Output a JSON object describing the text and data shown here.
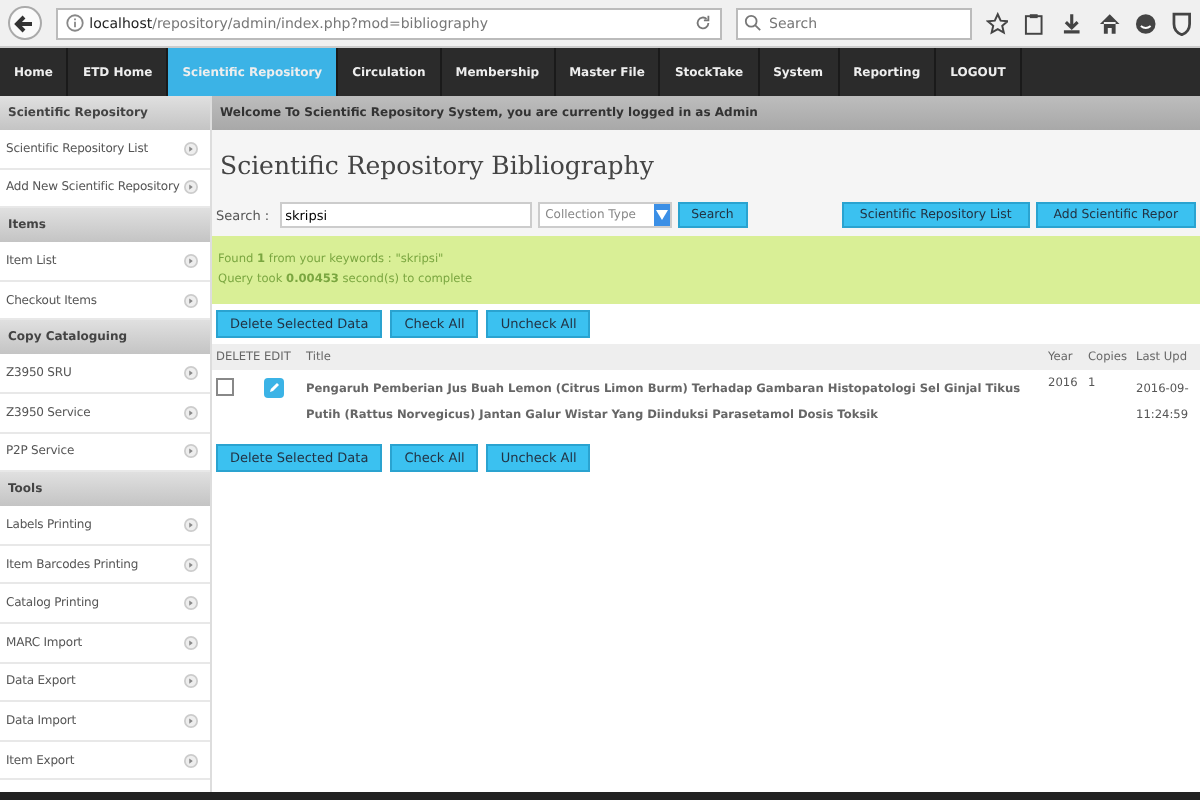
{
  "browser": {
    "url_host": "localhost",
    "url_path": "/repository/admin/index.php?mod=bibliography",
    "search_placeholder": "Search"
  },
  "nav": [
    {
      "label": "Home",
      "selected": false
    },
    {
      "label": "ETD Home",
      "selected": false
    },
    {
      "label": "Scientific Repository",
      "selected": true
    },
    {
      "label": "Circulation",
      "selected": false
    },
    {
      "label": "Membership",
      "selected": false
    },
    {
      "label": "Master File",
      "selected": false
    },
    {
      "label": "StockTake",
      "selected": false
    },
    {
      "label": "System",
      "selected": false
    },
    {
      "label": "Reporting",
      "selected": false
    },
    {
      "label": "LOGOUT",
      "selected": false
    }
  ],
  "sidebar": [
    {
      "kind": "header",
      "label": "Scientific Repository"
    },
    {
      "kind": "item",
      "label": "Scientific Repository List"
    },
    {
      "kind": "item",
      "label": "Add New Scientific Repository"
    },
    {
      "kind": "header",
      "label": "Items"
    },
    {
      "kind": "item",
      "label": "Item List"
    },
    {
      "kind": "item",
      "label": "Checkout Items"
    },
    {
      "kind": "header",
      "label": "Copy Cataloguing"
    },
    {
      "kind": "item",
      "label": "Z3950 SRU"
    },
    {
      "kind": "item",
      "label": "Z3950 Service"
    },
    {
      "kind": "item",
      "label": "P2P Service"
    },
    {
      "kind": "header",
      "label": "Tools"
    },
    {
      "kind": "item",
      "label": "Labels Printing"
    },
    {
      "kind": "item",
      "label": "Item Barcodes Printing"
    },
    {
      "kind": "item",
      "label": "Catalog Printing"
    },
    {
      "kind": "item",
      "label": "MARC Import"
    },
    {
      "kind": "item",
      "label": "Data Export"
    },
    {
      "kind": "item",
      "label": "Data Import"
    },
    {
      "kind": "item",
      "label": "Item Export"
    }
  ],
  "welcome": "Welcome To Scientific Repository System, you are currently logged in as Admin",
  "page_title": "Scientific Repository Bibliography",
  "search": {
    "label": "Search :",
    "value": "skripsi",
    "collection_type": "Collection Type",
    "button": "Search"
  },
  "action_buttons": [
    "Scientific Repository List",
    "Add Scientific Repor"
  ],
  "result_info": [
    "Found **1** from your keywords : \"skripsi\"",
    "Query took **0.00453** second(s) to complete"
  ],
  "table_buttons_top": [
    "Delete Selected Data",
    "Check All",
    "Uncheck All"
  ],
  "table": {
    "columns": [
      "DELETE",
      "EDIT",
      "Title",
      "Year",
      "Copies",
      "Last Upd"
    ],
    "rows": [
      {
        "checked": false,
        "title": "Pengaruh Pemberian Jus Buah Lemon (Citrus Limon Burm) Terhadap Gambaran Histopatologi Sel Ginjal Tikus Putih (Rattus Norvegicus) Jantan Galur Wistar Yang Diinduksi Parasetamol Dosis Toksik",
        "year": "2016",
        "copies": "1",
        "last_update": [
          "2016-09-",
          "11:24:59"
        ]
      }
    ]
  },
  "table_buttons_bottom": [
    "Delete Selected Data",
    "Check All",
    "Uncheck All"
  ]
}
